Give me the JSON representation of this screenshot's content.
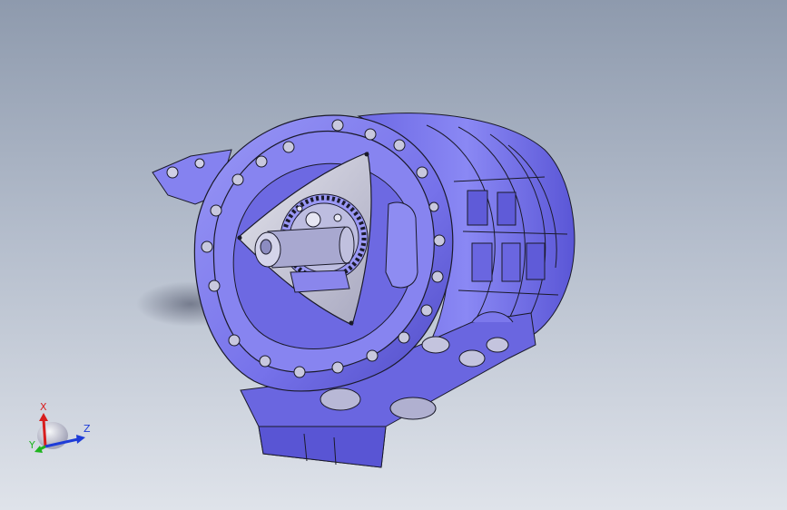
{
  "viewport": {
    "background_top": "#8e9aad",
    "background_bottom": "#dfe3ea"
  },
  "model": {
    "body_color": "#7a76ee",
    "face_color": "#8e8cf2",
    "shadow_color": "#5450c8",
    "rotor_color": "#d4d4dc",
    "edge_color": "#1a1a2a"
  },
  "triad": {
    "x_label": "X",
    "y_label": "Y",
    "z_label": "Z",
    "x_color": "#d81e1e",
    "y_color": "#1eb41e",
    "z_color": "#1e3cd8"
  }
}
